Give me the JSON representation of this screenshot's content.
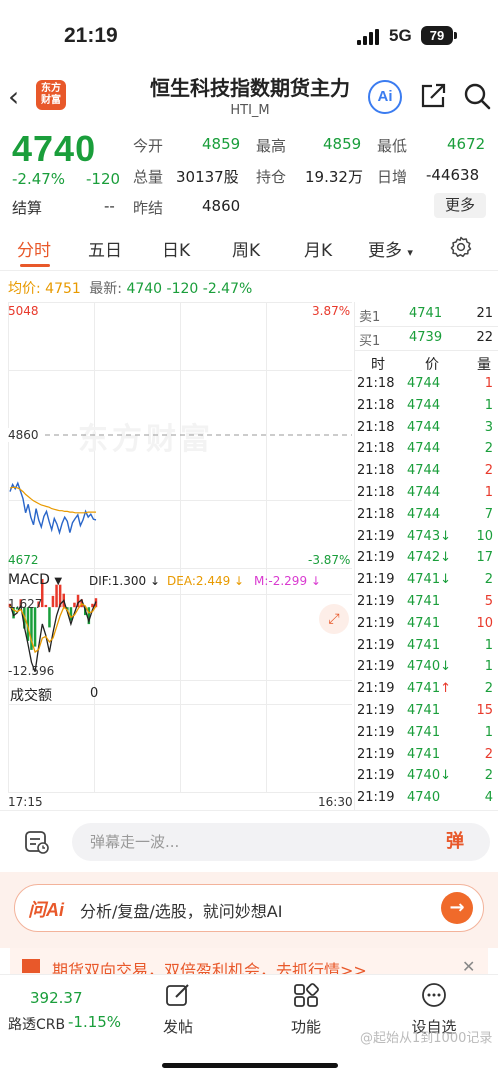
{
  "status_bar": {
    "time": "21:19",
    "network": "5G",
    "battery": "79"
  },
  "header": {
    "logo_text": "东方\n财富",
    "title": "恒生科技指数期货主力",
    "subtitle": "HTI_M",
    "ai_label": "Ai"
  },
  "quote": {
    "last_price": "4740",
    "change_pct": "-2.47%",
    "change_abs": "-120",
    "settle_label": "结算",
    "settle_value": "--",
    "fields": [
      {
        "label": "今开",
        "value": "4859",
        "color": "green"
      },
      {
        "label": "最高",
        "value": "4859",
        "color": "green"
      },
      {
        "label": "最低",
        "value": "4672",
        "color": "green"
      },
      {
        "label": "总量",
        "value": "30137股",
        "color": "black"
      },
      {
        "label": "持仓",
        "value": "19.32万",
        "color": "black"
      },
      {
        "label": "日增",
        "value": "-44638",
        "color": "black"
      },
      {
        "label": "昨结",
        "value": "4860",
        "color": "black"
      }
    ],
    "more_label": "更多"
  },
  "tabs": [
    {
      "label": "分时",
      "active": true
    },
    {
      "label": "五日",
      "active": false
    },
    {
      "label": "日K",
      "active": false
    },
    {
      "label": "周K",
      "active": false
    },
    {
      "label": "月K",
      "active": false
    },
    {
      "label": "更多",
      "active": false
    }
  ],
  "avg_row": {
    "avg_label": "均价:",
    "avg_value": "4751",
    "latest_label": "最新:",
    "latest_value": "4740",
    "latest_change": "-120",
    "latest_pct": "-2.47%"
  },
  "chart_axis": {
    "price_max": "5048",
    "pct_max": "3.87%",
    "price_ref": "4860",
    "price_min": "4672",
    "pct_min": "-3.87%",
    "time_start": "17:15",
    "time_end": "16:30"
  },
  "macd": {
    "select_label": "MACD",
    "dif": "DIF:1.300 ↓",
    "dea": "DEA:2.449 ↓",
    "m": "M:-2.299 ↓",
    "max_label": "1.627",
    "min_label": "-12.596"
  },
  "volume": {
    "label": "成交额",
    "value": "0"
  },
  "chart_data": {
    "type": "line",
    "price_range": [
      4672,
      5048
    ],
    "ref_price": 4860,
    "series": [
      {
        "name": "price",
        "values": [
          4780,
          4790,
          4784,
          4792,
          4781,
          4770,
          4750,
          4762,
          4744,
          4733,
          4756,
          4740,
          4730,
          4745,
          4752,
          4738,
          4726,
          4742,
          4734,
          4722,
          4735,
          4744,
          4738,
          4722,
          4736,
          4742,
          4747,
          4732,
          4740,
          4752,
          4744,
          4748,
          4741,
          4740
        ]
      },
      {
        "name": "avg",
        "values": [
          4785,
          4786,
          4786,
          4785,
          4783,
          4780,
          4776,
          4773,
          4770,
          4767,
          4765,
          4763,
          4761,
          4760,
          4759,
          4758,
          4756,
          4755,
          4754,
          4753,
          4753,
          4752,
          4752,
          4751,
          4751,
          4750,
          4750,
          4750,
          4750,
          4750,
          4751,
          4751,
          4751,
          4751
        ]
      }
    ],
    "macd_range": [
      -12.596,
      1.627
    ],
    "macd_dif": [
      0.5,
      -1.5,
      -1.0,
      0.3,
      -3.5,
      -6.5,
      -9.8,
      -11.5,
      -7.0,
      -3.0,
      -5.0,
      -8.0,
      -4.5,
      -1.5,
      0.5,
      1.2,
      -0.8,
      -3.0,
      -1.0,
      0.8,
      1.3,
      -0.5,
      -2.5,
      -0.5,
      1.0
    ],
    "macd_dea": [
      0.2,
      -0.5,
      -0.8,
      -0.4,
      -1.6,
      -3.5,
      -6.0,
      -8.0,
      -7.5,
      -5.5,
      -5.2,
      -6.2,
      -5.5,
      -3.5,
      -1.5,
      0.0,
      -0.5,
      -1.8,
      -1.4,
      -0.3,
      0.6,
      0.2,
      -1.0,
      -0.8,
      0.2
    ],
    "macd_hist": [
      0.6,
      -2.0,
      -0.4,
      1.4,
      -3.8,
      -6.0,
      -7.6,
      -7.0,
      1.0,
      5.0,
      0.4,
      -3.6,
      2.0,
      4.0,
      4.0,
      2.4,
      -0.6,
      -2.4,
      0.8,
      2.2,
      1.4,
      -1.4,
      -3.0,
      0.6,
      1.6
    ]
  },
  "orderbook": {
    "ask": {
      "label": "卖1",
      "price": "4741",
      "vol": "21"
    },
    "bid": {
      "label": "买1",
      "price": "4739",
      "vol": "22"
    },
    "headers": {
      "time": "时",
      "price": "价",
      "vol": "量"
    },
    "trades": [
      {
        "time": "21:18",
        "price": "4744",
        "vol": "1",
        "dir": ""
      },
      {
        "time": "21:18",
        "price": "4744",
        "vol": "1",
        "dir": ""
      },
      {
        "time": "21:18",
        "price": "4744",
        "vol": "3",
        "dir": ""
      },
      {
        "time": "21:18",
        "price": "4744",
        "vol": "2",
        "dir": ""
      },
      {
        "time": "21:18",
        "price": "4744",
        "vol": "2",
        "dir": ""
      },
      {
        "time": "21:18",
        "price": "4744",
        "vol": "1",
        "dir": ""
      },
      {
        "time": "21:18",
        "price": "4744",
        "vol": "7",
        "dir": ""
      },
      {
        "time": "21:19",
        "price": "4743",
        "vol": "10",
        "dir": "↓"
      },
      {
        "time": "21:19",
        "price": "4742",
        "vol": "17",
        "dir": "↓"
      },
      {
        "time": "21:19",
        "price": "4741",
        "vol": "2",
        "dir": "↓"
      },
      {
        "time": "21:19",
        "price": "4741",
        "vol": "5",
        "dir": ""
      },
      {
        "time": "21:19",
        "price": "4741",
        "vol": "10",
        "dir": ""
      },
      {
        "time": "21:19",
        "price": "4741",
        "vol": "1",
        "dir": ""
      },
      {
        "time": "21:19",
        "price": "4740",
        "vol": "1",
        "dir": "↓"
      },
      {
        "time": "21:19",
        "price": "4741",
        "vol": "2",
        "dir": "↑"
      },
      {
        "time": "21:19",
        "price": "4741",
        "vol": "15",
        "dir": ""
      },
      {
        "time": "21:19",
        "price": "4741",
        "vol": "1",
        "dir": ""
      },
      {
        "time": "21:19",
        "price": "4741",
        "vol": "2",
        "dir": ""
      },
      {
        "time": "21:19",
        "price": "4740",
        "vol": "2",
        "dir": "↓"
      },
      {
        "time": "21:19",
        "price": "4740",
        "vol": "4",
        "dir": ""
      }
    ],
    "vol_colors": [
      "red",
      "green",
      "green",
      "green",
      "red",
      "red",
      "green",
      "green",
      "green",
      "green",
      "red",
      "red",
      "green",
      "green",
      "green",
      "red",
      "green",
      "red",
      "green",
      "green"
    ]
  },
  "comment": {
    "placeholder": "弹幕走一波...",
    "danmu_label": "弹"
  },
  "ai_banner": {
    "logo": "问Ai",
    "text": "分析/复盘/选股，就问妙想AI"
  },
  "promo": {
    "text": "期货双向交易，双倍盈利机会，去抓行情>>"
  },
  "bottom_nav": {
    "crb_value": "392.37",
    "crb_label": "路透CRB",
    "crb_change": "-1.15%",
    "items": [
      {
        "label": "发帖",
        "icon": "edit-icon"
      },
      {
        "label": "功能",
        "icon": "grid-icon"
      },
      {
        "label": "设自选",
        "icon": "more-icon"
      }
    ]
  },
  "watermark": "@起始从1到1000记录",
  "colors": {
    "up": "#e8392b",
    "down": "#1a9e3b",
    "accent": "#e8582a",
    "price_line": "#2a66c9",
    "avg_line": "#e89a00"
  }
}
